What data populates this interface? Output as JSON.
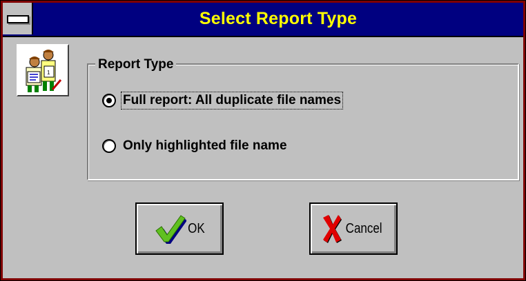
{
  "window": {
    "title": "Select Report Type",
    "title_color": "#ffff00",
    "titlebar_color": "#000080",
    "frame_color": "#7f0000"
  },
  "icons": {
    "system_menu": "system-menu-icon",
    "app": "people-report-icon"
  },
  "group": {
    "legend": "Report Type",
    "options": [
      {
        "label": "Full report: All duplicate file names",
        "selected": true
      },
      {
        "label": "Only highlighted file name",
        "selected": false
      }
    ]
  },
  "buttons": {
    "ok_label": "OK",
    "cancel_label": "Cancel",
    "ok_icon": "checkmark-icon",
    "cancel_icon": "red-x-icon"
  }
}
